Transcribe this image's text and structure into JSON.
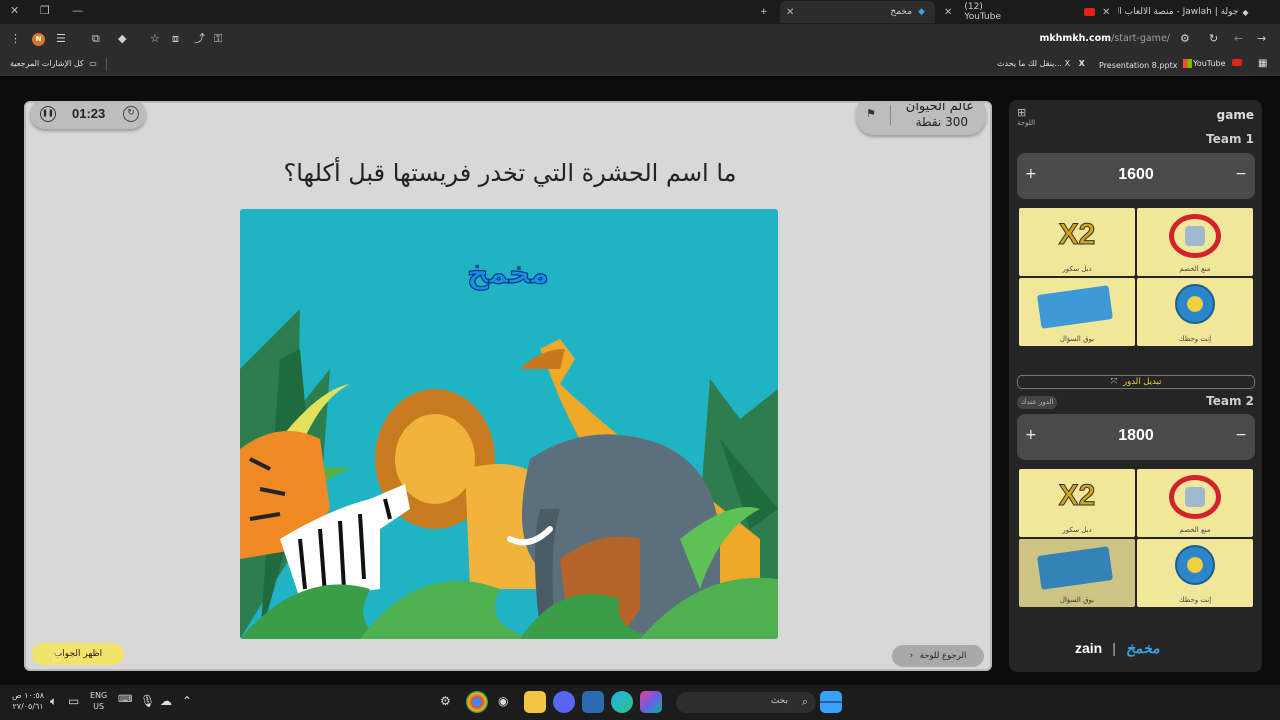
{
  "browser": {
    "tabs": [
      {
        "title": "جولة | Jawlah - منصة الألعاب الث..",
        "active": false
      },
      {
        "title": "(12) YouTube",
        "active": false
      },
      {
        "title": "مخمخ",
        "active": true
      }
    ],
    "new_tab_label": "+",
    "url_host": "mkhmkh.com",
    "url_path": "/start-game/",
    "profile_initial": "N",
    "bookmarks": {
      "all_label": "كل الإشارات المرجعية",
      "items": [
        "YouTube",
        "Presentation 8.pptx",
        "ينقل لك ما يحدث... X"
      ]
    }
  },
  "game": {
    "timer": "01:23",
    "category": {
      "name": "عالم الحيوان",
      "points": "300 نقطة"
    },
    "question": "ما اسم الحشرة التي تخدر فريستها قبل أكلها؟",
    "image_logo_text": "مخمخ",
    "show_answer_label": "اظهر الجواب",
    "back_to_board_label": "الرجوع للوحة"
  },
  "panel": {
    "title": "game",
    "board_label": "اللوحة",
    "switch_turn_label": "تبديل الدور",
    "your_turn_label": "الدور عندك",
    "teams": [
      {
        "name": "Team 1",
        "score": "1600",
        "cards": [
          {
            "label": "دبل سكور",
            "icon": "x2-icon",
            "used": false
          },
          {
            "label": "منع الخصم",
            "icon": "block-opponent-icon",
            "used": false
          },
          {
            "label": "بوق السؤال",
            "icon": "cards-icon",
            "used": false
          },
          {
            "label": "إنت وحظك",
            "icon": "wheel-icon",
            "used": false
          }
        ]
      },
      {
        "name": "Team 2",
        "score": "1800",
        "cards": [
          {
            "label": "دبل سكور",
            "icon": "x2-icon",
            "used": false
          },
          {
            "label": "منع الخصم",
            "icon": "block-opponent-icon",
            "used": false
          },
          {
            "label": "بوق السؤال",
            "icon": "cards-icon",
            "used": true
          },
          {
            "label": "إنت وحظك",
            "icon": "wheel-icon",
            "used": false
          }
        ]
      }
    ],
    "sponsor": {
      "left": "zain",
      "right": "مخمخ"
    }
  },
  "taskbar": {
    "search_label": "بحث",
    "time": "١٠:٥٨ ص",
    "date": "٢٧/٠٥/٦١",
    "lang_top": "ENG",
    "lang_bottom": "US"
  },
  "colors": {
    "accent_yellow": "#f2e36a",
    "picture_bg": "#1fb3c3",
    "panel_bg": "#252525",
    "stage_bg": "#d8d8d8"
  }
}
